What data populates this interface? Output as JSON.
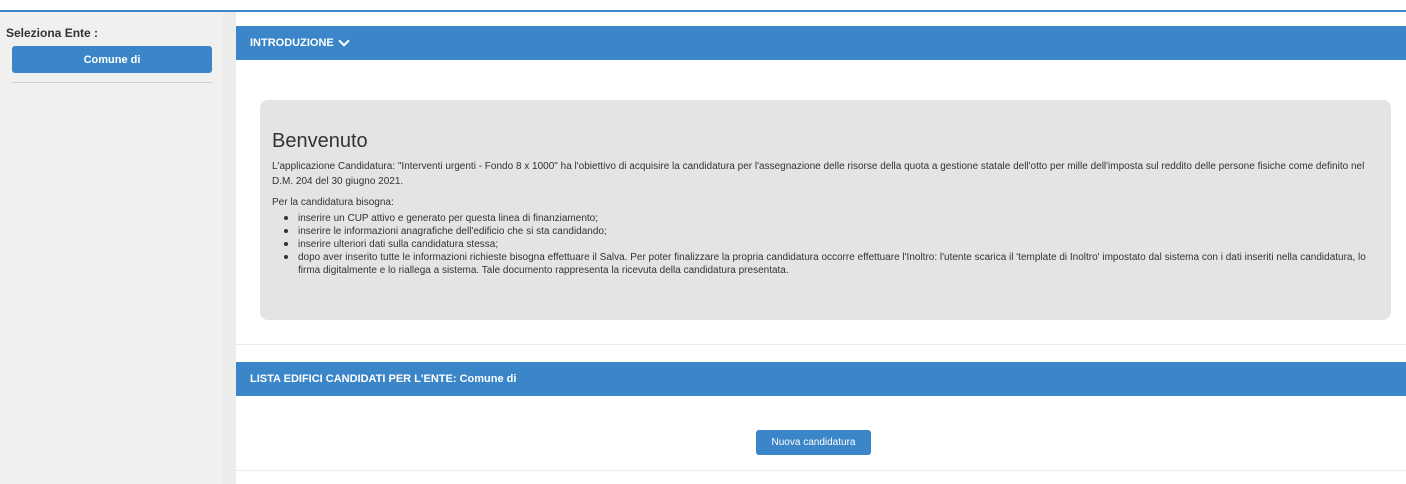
{
  "sidebar": {
    "label": "Seleziona Ente :",
    "selected_ente": "Comune di"
  },
  "intro": {
    "header": "INTRODUZIONE",
    "title": "Benvenuto",
    "paragraph1": "L'applicazione Candidatura: \"Interventi urgenti - Fondo 8 x 1000\" ha l'obiettivo di acquisire la candidatura per l'assegnazione delle risorse della quota a gestione statale dell'otto per mille dell'imposta sul reddito delle persone fisiche come definito nel D.M. 204 del 30 giugno 2021.",
    "paragraph2": "Per la candidatura bisogna:",
    "items": [
      "inserire un CUP attivo e generato per questa linea di finanziamento;",
      "inserire le informazioni anagrafiche dell'edificio che si sta candidando;",
      "inserire ulteriori dati sulla candidatura stessa;",
      "dopo aver inserito tutte le informazioni richieste bisogna effettuare il Salva. Per poter finalizzare la propria candidatura occorre effettuare l'Inoltro: l'utente scarica il 'template di Inoltro' impostato dal sistema con i dati inseriti nella candidatura, lo firma digitalmente e lo riallega a sistema. Tale documento rappresenta la ricevuta della candidatura presentata."
    ]
  },
  "list": {
    "header": "LISTA EDIFICI CANDIDATI PER L'ENTE: Comune di",
    "new_button": "Nuova candidatura"
  },
  "colors": {
    "accent": "#3a86c8",
    "sidebar_bg": "#f0f0f0",
    "box_bg": "#e4e4e4"
  }
}
